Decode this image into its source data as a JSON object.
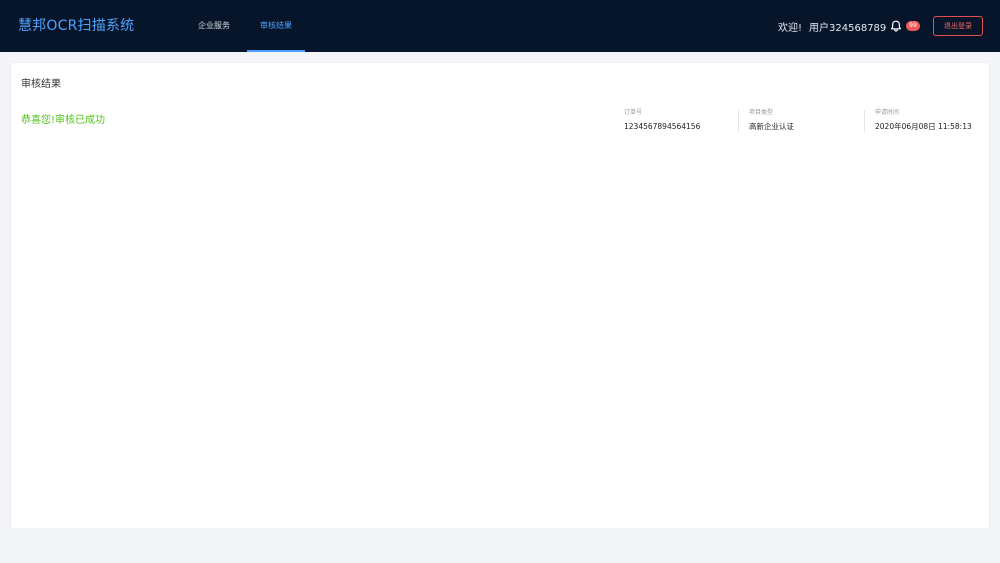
{
  "header": {
    "logo": "慧邦OCR扫描系统",
    "nav": [
      {
        "label": "企业服务"
      },
      {
        "label": "审核结果"
      }
    ],
    "welcome": "欢迎!",
    "username": "用户324568789",
    "notification_count": "99",
    "logout_label": "退出登录",
    "accent_color": "#4da3ff"
  },
  "result": {
    "title": "审核结果",
    "message": "恭喜您!审核已成功",
    "success_color": "#52c41a",
    "fields": [
      {
        "label": "订单号",
        "value": "1234567894564156"
      },
      {
        "label": "项目类型",
        "value": "高新企业认证"
      },
      {
        "label": "申请时间",
        "value": "2020年06月08日 11:58:13"
      }
    ]
  }
}
